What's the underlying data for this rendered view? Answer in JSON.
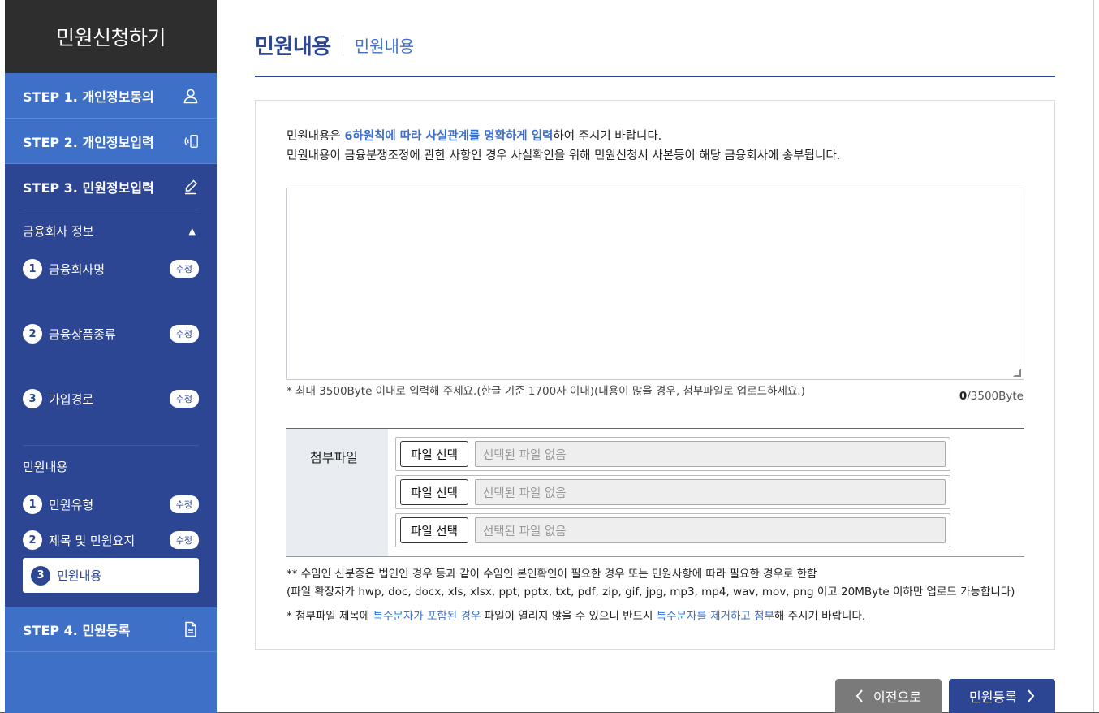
{
  "sidebar": {
    "header": "민원신청하기",
    "steps": [
      {
        "label": "STEP 1. 개인정보동의",
        "icon": "person-icon"
      },
      {
        "label": "STEP 2. 개인정보입력",
        "icon": "mobile-signal-icon"
      },
      {
        "label": "STEP 3. 민원정보입력",
        "icon": "pencil-icon"
      },
      {
        "label": "STEP 4. 민원등록",
        "icon": "document-icon"
      }
    ],
    "section1": {
      "title": "금융회사 정보",
      "toggle": "▲",
      "items": [
        {
          "num": "1",
          "label": "금융회사명",
          "badge": "수정"
        },
        {
          "num": "2",
          "label": "금융상품종류",
          "badge": "수정"
        },
        {
          "num": "3",
          "label": "가입경로",
          "badge": "수정"
        }
      ]
    },
    "section2": {
      "title": "민원내용",
      "items": [
        {
          "num": "1",
          "label": "민원유형",
          "badge": "수정"
        },
        {
          "num": "2",
          "label": "제목 및 민원요지",
          "badge": "수정"
        },
        {
          "num": "3",
          "label": "민원내용"
        }
      ]
    }
  },
  "main": {
    "title": "민원내용",
    "subtitle": "민원내용",
    "intro": {
      "line1_a": "민원내용은 ",
      "line1_hl": "6하원칙에 따라 사실관계를 명확하게 입력",
      "line1_b": "하여 주시기 바랍니다.",
      "line2": "민원내용이 금융분쟁조정에 관한 사항인 경우 사실확인을 위해 민원신청서 사본등이 해당 금융회사에 송부됩니다."
    },
    "textarea_value": "",
    "limit_note": "* 최대 3500Byte 이내로 입력해 주세요.(한글 기준 1700자 이내)(내용이 많을 경우, 첨부파일로 업로드하세요.)",
    "counter_value": "0",
    "counter_max": "/3500Byte",
    "attach": {
      "label": "첨부파일",
      "rows": [
        {
          "button": "파일 선택",
          "placeholder": "선택된 파일 없음"
        },
        {
          "button": "파일 선택",
          "placeholder": "선택된 파일 없음"
        },
        {
          "button": "파일 선택",
          "placeholder": "선택된 파일 없음"
        }
      ]
    },
    "notes": {
      "n1": "** 수임인 신분증은 법인인 경우 등과 같이 수임인 본인확인이 필요한 경우 또는 민원사항에 따라 필요한 경우로 한함",
      "n2": "(파일 확장자가 hwp, doc, docx, xls, xlsx, ppt, pptx, txt, pdf, zip, gif, jpg, mp3, mp4, wav, mov, png 이고 20MByte 이하만 업로드 가능합니다)",
      "n3_a": "* 첨부파일 제목에 ",
      "n3_hl1": "특수문자가 포함된 경우",
      "n3_b": " 파일이 열리지 않을 수 있으니 반드시 ",
      "n3_hl2": "특수문자를 제거하고 첨부",
      "n3_c": "해 주시기 바랍니다."
    }
  },
  "buttons": {
    "prev": "이전으로",
    "next": "민원등록"
  },
  "colors": {
    "primary": "#2c4694",
    "accent": "#3d6fc8",
    "sidebar": "#3f70c7",
    "header_bg": "#2e2e2e",
    "prev_button": "#7a7a7a"
  }
}
